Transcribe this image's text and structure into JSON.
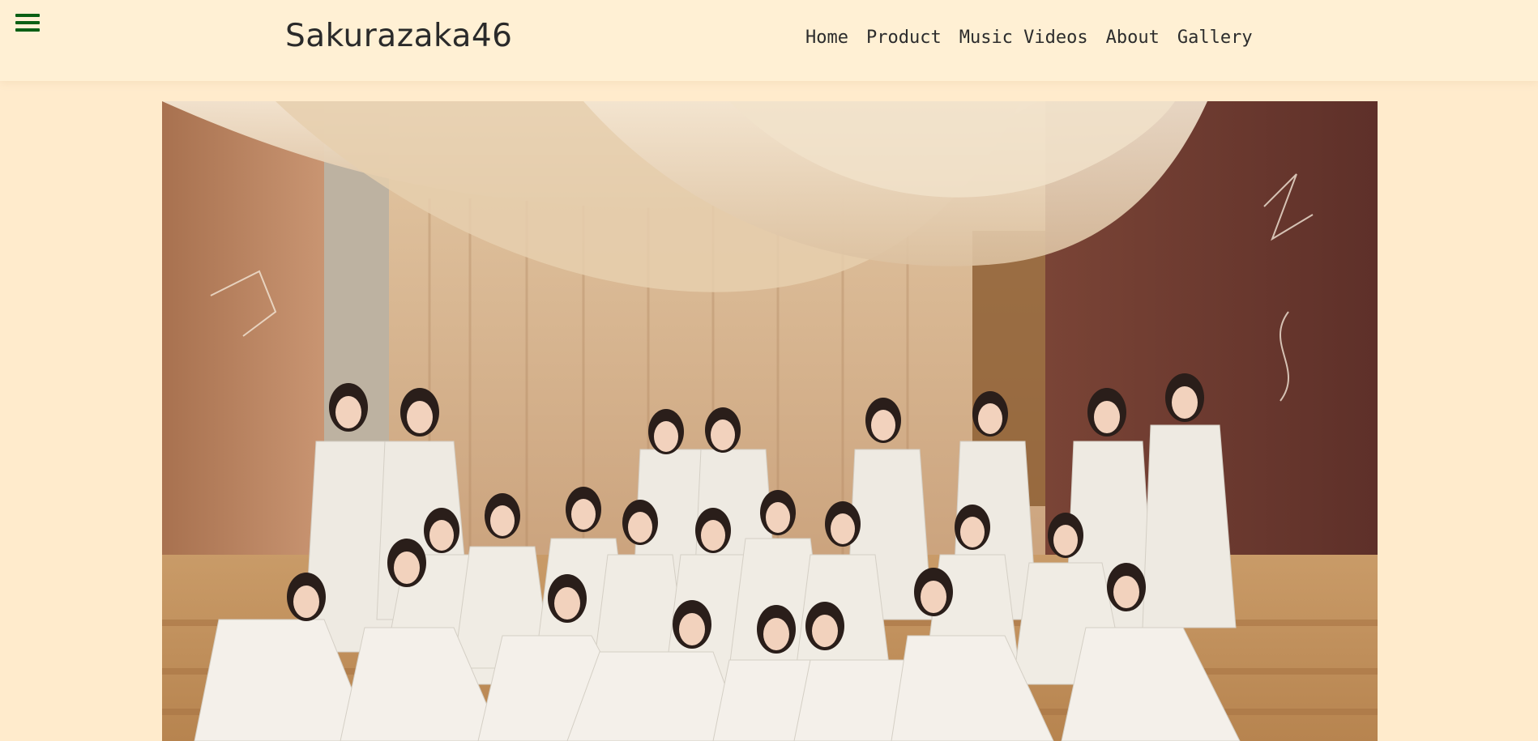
{
  "header": {
    "logo": "Sakurazaka46",
    "menu_icon": "hamburger-menu-icon"
  },
  "nav": {
    "items": [
      {
        "label": "Home"
      },
      {
        "label": "Product"
      },
      {
        "label": "Music Videos"
      },
      {
        "label": "About"
      },
      {
        "label": "Gallery"
      }
    ]
  },
  "colors": {
    "page_background": "#ffebcc",
    "header_background": "#fff0d4",
    "menu_icon": "#0a5f14",
    "text": "#2c2c2c"
  }
}
